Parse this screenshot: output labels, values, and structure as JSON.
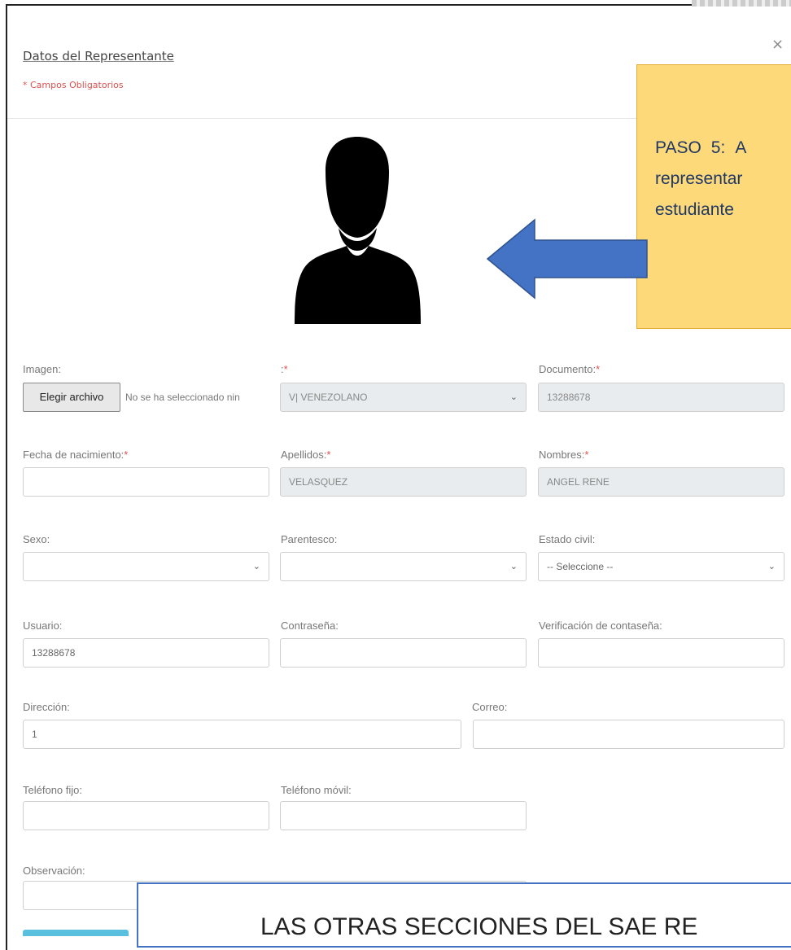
{
  "modal": {
    "title": "Datos del Representante",
    "required_note": "* Campos Obligatorios",
    "close_symbol": "×"
  },
  "callout": {
    "line1_a": "PASO",
    "line1_b": "5:",
    "line1_c": "A",
    "line2": "representar",
    "line3": "estudiante"
  },
  "fields": {
    "imagen_label": "Imagen:",
    "file_button": "Elegir archivo",
    "file_status": "No se ha seleccionado nin",
    "nacionalidad_label": ":",
    "nacionalidad_value": "V| VENEZOLANO",
    "documento_label": "Documento:",
    "documento_value": "13288678",
    "fecha_label": "Fecha de nacimiento:",
    "fecha_value": "",
    "apellidos_label": "Apellidos:",
    "apellidos_value": "VELASQUEZ",
    "nombres_label": "Nombres:",
    "nombres_value": "ANGEL RENE",
    "sexo_label": "Sexo:",
    "sexo_value": "",
    "parentesco_label": "Parentesco:",
    "parentesco_value": "",
    "estado_label": "Estado civil:",
    "estado_value": "-- Seleccione --",
    "usuario_label": "Usuario:",
    "usuario_value": "13288678",
    "contrasena_label": "Contraseña:",
    "verificacion_label": "Verificación de contaseña:",
    "direccion_label": "Dirección:",
    "direccion_value": "1",
    "correo_label": "Correo:",
    "telefono_fijo_label": "Teléfono fijo:",
    "telefono_movil_label": "Teléfono móvil:",
    "observacion_label": "Observación:",
    "required_mark": "*"
  },
  "banner": {
    "text": "LAS OTRAS SECCIONES DEL SAE RE"
  },
  "icons": {
    "avatar": "user-silhouette-icon",
    "arrow": "left-arrow-icon",
    "chevron": "chevron-down-icon"
  },
  "colors": {
    "callout_bg": "#fed97a",
    "arrow_fill": "#4472c4",
    "required": "#d9534f"
  }
}
